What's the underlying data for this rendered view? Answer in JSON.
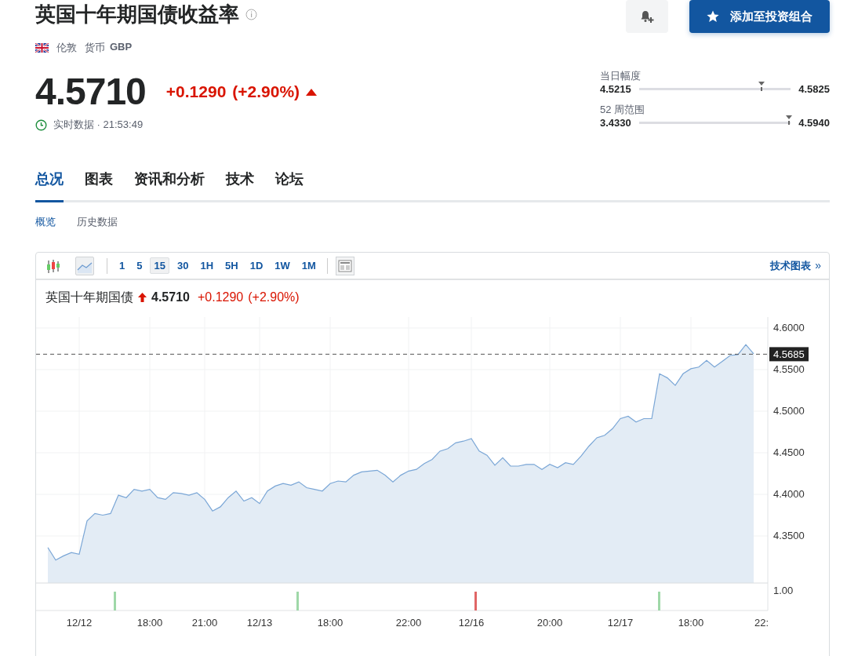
{
  "header": {
    "title": "英国十年期国债收益率",
    "location": "伦敦",
    "currency_label": "货币",
    "currency": "GBP",
    "portfolio_button": "添加至投资组合"
  },
  "quote": {
    "price": "4.5710",
    "change": "+0.1290",
    "change_percent": "(+2.90%)",
    "rising": true,
    "status": "实时数据 · 21:53:49"
  },
  "ranges": [
    {
      "label": "当日幅度",
      "low": "4.5215",
      "high": "4.5825",
      "level": 0.81
    },
    {
      "label": "52 周范围",
      "low": "3.4330",
      "high": "4.5940",
      "level": 0.99
    }
  ],
  "tabs": [
    {
      "label": "总况",
      "selected": true
    },
    {
      "label": "图表",
      "selected": false
    },
    {
      "label": "资讯和分析",
      "selected": false
    },
    {
      "label": "技术",
      "selected": false
    },
    {
      "label": "论坛",
      "selected": false
    }
  ],
  "subtabs": [
    {
      "label": "概览",
      "selected": true
    },
    {
      "label": "历史数据",
      "selected": false
    }
  ],
  "chart": {
    "toolbar": {
      "chart_types": [
        {
          "kind": "candlestick",
          "selected": false
        },
        {
          "kind": "area",
          "selected": true
        }
      ],
      "intervals": [
        {
          "label": "1",
          "selected": false
        },
        {
          "label": "5",
          "selected": false
        },
        {
          "label": "15",
          "selected": true
        },
        {
          "label": "30",
          "selected": false
        },
        {
          "label": "1H",
          "selected": false
        },
        {
          "label": "5H",
          "selected": false
        },
        {
          "label": "1D",
          "selected": false
        },
        {
          "label": "1W",
          "selected": false
        },
        {
          "label": "1M",
          "selected": false
        }
      ],
      "link": "技术图表",
      "link_arrow": "»"
    },
    "legend": {
      "rising": true,
      "price": "4.5710",
      "change": "+0.1290",
      "change_percent": "(+2.90%)"
    },
    "chart_data": {
      "type": "area",
      "grid": true,
      "categories": [
        null,
        null,
        null,
        null,
        "12/12",
        null,
        null,
        null,
        null,
        null,
        null,
        null,
        null,
        "18:00",
        null,
        null,
        null,
        null,
        null,
        null,
        "21:00",
        null,
        null,
        null,
        null,
        null,
        null,
        "12/13",
        null,
        null,
        null,
        null,
        null,
        null,
        null,
        null,
        "18:00",
        null,
        null,
        null,
        null,
        null,
        null,
        null,
        null,
        null,
        "22:00",
        null,
        null,
        null,
        null,
        null,
        null,
        null,
        "12/16",
        null,
        null,
        null,
        null,
        null,
        null,
        null,
        null,
        null,
        "20:00",
        null,
        null,
        null,
        null,
        null,
        null,
        null,
        null,
        "12/17",
        null,
        null,
        null,
        null,
        null,
        null,
        null,
        null,
        "18:00",
        null,
        null,
        null,
        null,
        null,
        null,
        null,
        null,
        null
      ],
      "ylim": [
        4.2934,
        4.6132
      ],
      "yticks": [
        {
          "value": 4.35,
          "label": "4.3500"
        },
        {
          "value": 4.4,
          "label": "4.4000"
        },
        {
          "value": 4.45,
          "label": "4.4500"
        },
        {
          "value": 4.5,
          "label": "4.5000"
        },
        {
          "value": 4.55,
          "label": "4.5500"
        },
        {
          "value": 4.6,
          "label": "4.6000"
        }
      ],
      "series": [
        {
          "name": "英国十年期国债",
          "color": "#7aa6d6",
          "values": [
            4.336,
            4.321,
            4.326,
            4.33,
            4.328,
            4.368,
            4.377,
            4.375,
            4.377,
            4.399,
            4.396,
            4.406,
            4.404,
            4.406,
            4.396,
            4.394,
            4.402,
            4.401,
            4.399,
            4.402,
            4.394,
            4.38,
            4.385,
            4.396,
            4.404,
            4.392,
            4.396,
            4.389,
            4.404,
            4.41,
            4.413,
            4.411,
            4.415,
            4.408,
            4.406,
            4.404,
            4.413,
            4.416,
            4.415,
            4.423,
            4.427,
            4.428,
            4.429,
            4.423,
            4.415,
            4.423,
            4.428,
            4.43,
            4.437,
            4.442,
            4.452,
            4.455,
            4.462,
            4.464,
            4.467,
            4.452,
            4.447,
            4.435,
            4.444,
            4.434,
            4.434,
            4.436,
            4.436,
            4.43,
            4.436,
            4.432,
            4.438,
            4.436,
            4.446,
            4.458,
            4.468,
            4.471,
            4.479,
            4.491,
            4.494,
            4.487,
            4.491,
            4.491,
            4.545,
            4.54,
            4.531,
            4.545,
            4.551,
            4.553,
            4.561,
            4.553,
            4.56,
            4.567,
            4.568,
            4.58,
            4.569,
            null
          ]
        }
      ],
      "ref_lines": [
        {
          "axis": "y",
          "value": 4.5685,
          "label": "4.5685"
        }
      ]
    },
    "edge_axis_label": "22:",
    "volume": {
      "tick": "1.00",
      "bars": [
        {
          "color": "#9fd8a8"
        },
        {
          "color": "#9fd8a8"
        },
        {
          "color": "#e06666"
        },
        {
          "color": "#9fd8a8"
        }
      ]
    }
  }
}
